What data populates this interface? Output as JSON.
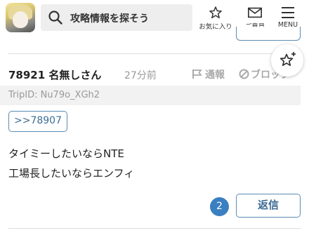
{
  "header": {
    "search_placeholder": "攻略情報を探そう",
    "favorites_label": "お気に入り",
    "opinion_label": "ご意見",
    "menu_label": "MENU"
  },
  "comment": {
    "number_and_name": "78921 名無しさん",
    "time_ago": "27分前",
    "report_label": "通報",
    "block_label": "ブロック",
    "trip_id": "TripID: Nu79o_XGh2",
    "anchor_label": ">>78907",
    "body_lines": [
      "タイミーしたいならNTE",
      "工場長したいならエンフィ"
    ],
    "reply_count": "2",
    "reply_label": "返信"
  },
  "colors": {
    "accent": "#3a7fc0",
    "border_blue": "#5b8cb3",
    "muted": "#999999"
  }
}
